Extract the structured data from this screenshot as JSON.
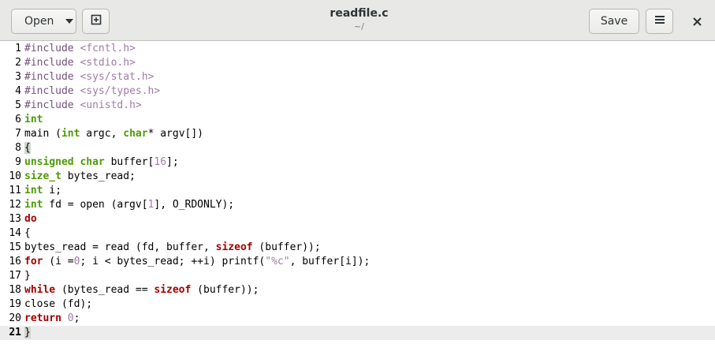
{
  "header": {
    "open_label": "Open",
    "save_label": "Save",
    "title": "readfile.c",
    "subtitle": "~/",
    "icons": {
      "open_dropdown": "chevron-down-icon",
      "new_document": "new-document-icon",
      "menu": "hamburger-menu-icon",
      "close": "close-icon"
    }
  },
  "editor": {
    "current_line": 21,
    "lines": [
      {
        "n": "1",
        "segments": [
          {
            "t": "#include ",
            "c": "pp"
          },
          {
            "t": "<fcntl.h>",
            "c": "str"
          }
        ]
      },
      {
        "n": "2",
        "segments": [
          {
            "t": "#include ",
            "c": "pp"
          },
          {
            "t": "<stdio.h>",
            "c": "str"
          }
        ]
      },
      {
        "n": "3",
        "segments": [
          {
            "t": "#include ",
            "c": "pp"
          },
          {
            "t": "<sys/stat.h>",
            "c": "str"
          }
        ]
      },
      {
        "n": "4",
        "segments": [
          {
            "t": "#include ",
            "c": "pp"
          },
          {
            "t": "<sys/types.h>",
            "c": "str"
          }
        ]
      },
      {
        "n": "5",
        "segments": [
          {
            "t": "#include ",
            "c": "pp"
          },
          {
            "t": "<unistd.h>",
            "c": "str"
          }
        ]
      },
      {
        "n": "6",
        "segments": [
          {
            "t": "int",
            "c": "kw"
          }
        ]
      },
      {
        "n": "7",
        "segments": [
          {
            "t": "main (",
            "c": ""
          },
          {
            "t": "int",
            "c": "kw"
          },
          {
            "t": " argc, ",
            "c": ""
          },
          {
            "t": "char",
            "c": "kw"
          },
          {
            "t": "* argv[])",
            "c": ""
          }
        ]
      },
      {
        "n": "8",
        "segments": [
          {
            "t": "{",
            "c": "brace-hl"
          }
        ]
      },
      {
        "n": "9",
        "segments": [
          {
            "t": "unsigned",
            "c": "kw"
          },
          {
            "t": " ",
            "c": ""
          },
          {
            "t": "char",
            "c": "kw"
          },
          {
            "t": " buffer[",
            "c": ""
          },
          {
            "t": "16",
            "c": "num"
          },
          {
            "t": "];",
            "c": ""
          }
        ]
      },
      {
        "n": "10",
        "segments": [
          {
            "t": "size_t",
            "c": "kw"
          },
          {
            "t": " bytes_read;",
            "c": ""
          }
        ]
      },
      {
        "n": "11",
        "segments": [
          {
            "t": "int",
            "c": "kw"
          },
          {
            "t": " i;",
            "c": ""
          }
        ]
      },
      {
        "n": "12",
        "segments": [
          {
            "t": "int",
            "c": "kw"
          },
          {
            "t": " fd = open (argv[",
            "c": ""
          },
          {
            "t": "1",
            "c": "num"
          },
          {
            "t": "], O_RDONLY);",
            "c": ""
          }
        ]
      },
      {
        "n": "13",
        "segments": [
          {
            "t": "do",
            "c": "kw2"
          }
        ]
      },
      {
        "n": "14",
        "segments": [
          {
            "t": "{",
            "c": ""
          }
        ]
      },
      {
        "n": "15",
        "segments": [
          {
            "t": "bytes_read = read (fd, buffer, ",
            "c": ""
          },
          {
            "t": "sizeof",
            "c": "kw2"
          },
          {
            "t": " (buffer));",
            "c": ""
          }
        ]
      },
      {
        "n": "16",
        "segments": [
          {
            "t": "for",
            "c": "kw2"
          },
          {
            "t": " (i =",
            "c": ""
          },
          {
            "t": "0",
            "c": "num"
          },
          {
            "t": "; i < bytes_read; ++i) printf(",
            "c": ""
          },
          {
            "t": "\"%c\"",
            "c": "str"
          },
          {
            "t": ", buffer[i]);",
            "c": ""
          }
        ]
      },
      {
        "n": "17",
        "segments": [
          {
            "t": "}",
            "c": ""
          }
        ]
      },
      {
        "n": "18",
        "segments": [
          {
            "t": "while",
            "c": "kw2"
          },
          {
            "t": " (bytes_read == ",
            "c": ""
          },
          {
            "t": "sizeof",
            "c": "kw2"
          },
          {
            "t": " (buffer));",
            "c": ""
          }
        ]
      },
      {
        "n": "19",
        "segments": [
          {
            "t": "close (fd);",
            "c": ""
          }
        ]
      },
      {
        "n": "20",
        "segments": [
          {
            "t": "return",
            "c": "kw2"
          },
          {
            "t": " ",
            "c": ""
          },
          {
            "t": "0",
            "c": "num"
          },
          {
            "t": ";",
            "c": ""
          }
        ]
      },
      {
        "n": "21",
        "segments": [
          {
            "t": "}",
            "c": "brace-hl"
          }
        ]
      }
    ]
  },
  "colors": {
    "keyword_type": "#4e9a06",
    "keyword_control": "#a40000",
    "string_literal": "#a07ca7",
    "preprocessor": "#75507b",
    "current_line": "#ececec"
  }
}
